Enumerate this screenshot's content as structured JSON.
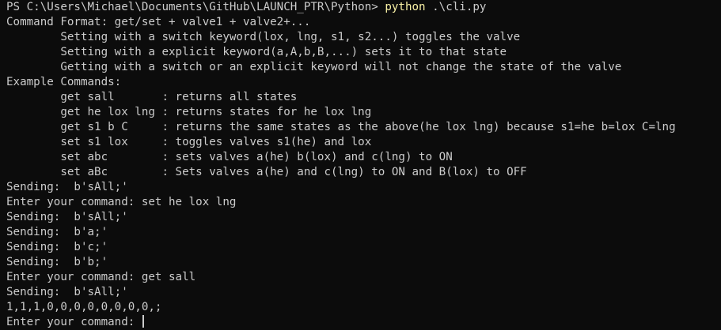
{
  "terminal": {
    "prompt": "PS C:\\Users\\Michael\\Documents\\GitHub\\LAUNCH_PTR\\Python> ",
    "command_program": "python",
    "command_args": " .\\cli.py",
    "output_lines": [
      "Command Format: get/set + valve1 + valve2+...",
      "        Setting with a switch keyword(lox, lng, s1, s2...) toggles the valve",
      "        Setting with a explicit keyword(a,A,b,B,...) sets it to that state",
      "        Getting with a switch or an explicit keyword will not change the state of the valve",
      "Example Commands:",
      "        get sall       : returns all states",
      "        get he lox lng : returns states for he lox lng",
      "        get s1 b C     : returns the same states as the above(he lox lng) because s1=he b=lox C=lng",
      "        set s1 lox     : toggles valves s1(he) and lox",
      "        set abc        : sets valves a(he) b(lox) and c(lng) to ON",
      "        set aBc        : Sets valves a(he) and c(lng) to ON and B(lox) to OFF",
      "Sending:  b'sAll;'",
      "Enter your command: set he lox lng",
      "Sending:  b'sAll;'",
      "Sending:  b'a;'",
      "Sending:  b'c;'",
      "Sending:  b'b;'",
      "Enter your command: get sall",
      "Sending:  b'sAll;'",
      "1,1,1,0,0,0,0,0,0,0,0,;"
    ],
    "input_prompt": "Enter your command: "
  }
}
